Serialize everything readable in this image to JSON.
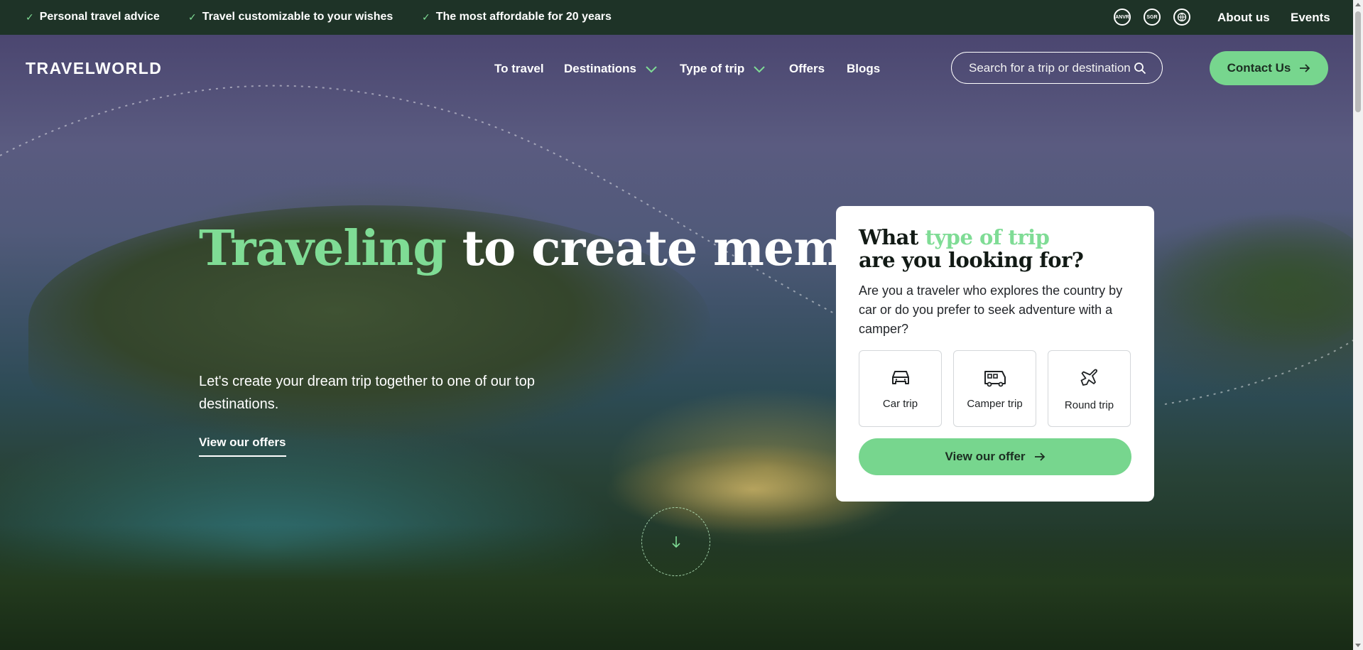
{
  "topbar": {
    "usps": [
      "Personal travel advice",
      "Travel customizable to your wishes",
      "The most affordable for 20 years"
    ],
    "badges": [
      "ANVR",
      "SGR",
      "globe"
    ],
    "links": {
      "about": "About us",
      "events": "Events"
    }
  },
  "header": {
    "logo": "TRAVELWORLD",
    "nav": {
      "to_travel": "To travel",
      "destinations": "Destinations",
      "type_of_trip": "Type of trip",
      "offers": "Offers",
      "blogs": "Blogs"
    },
    "search": {
      "placeholder": "Search for a trip or destination"
    },
    "contact": "Contact Us"
  },
  "hero": {
    "title_highlight": "Traveling",
    "title_rest": " to create memories",
    "subtitle": "Let's create your dream trip together to one of our top destinations.",
    "link": "View our offers"
  },
  "card": {
    "title_start": "What ",
    "title_highlight": "type of trip",
    "title_end": "are you looking for?",
    "text": "Are you a traveler who explores the country by car or do you prefer to seek adventure with a camper?",
    "options": [
      {
        "label": "Car trip",
        "icon": "car-icon"
      },
      {
        "label": "Camper trip",
        "icon": "camper-icon"
      },
      {
        "label": "Round trip",
        "icon": "plane-icon"
      }
    ],
    "cta": "View our offer"
  },
  "colors": {
    "accent": "#77d68e",
    "accent_text": "#7fdc95",
    "topbar": "#1e3327",
    "dark_text": "#1c2e22"
  }
}
